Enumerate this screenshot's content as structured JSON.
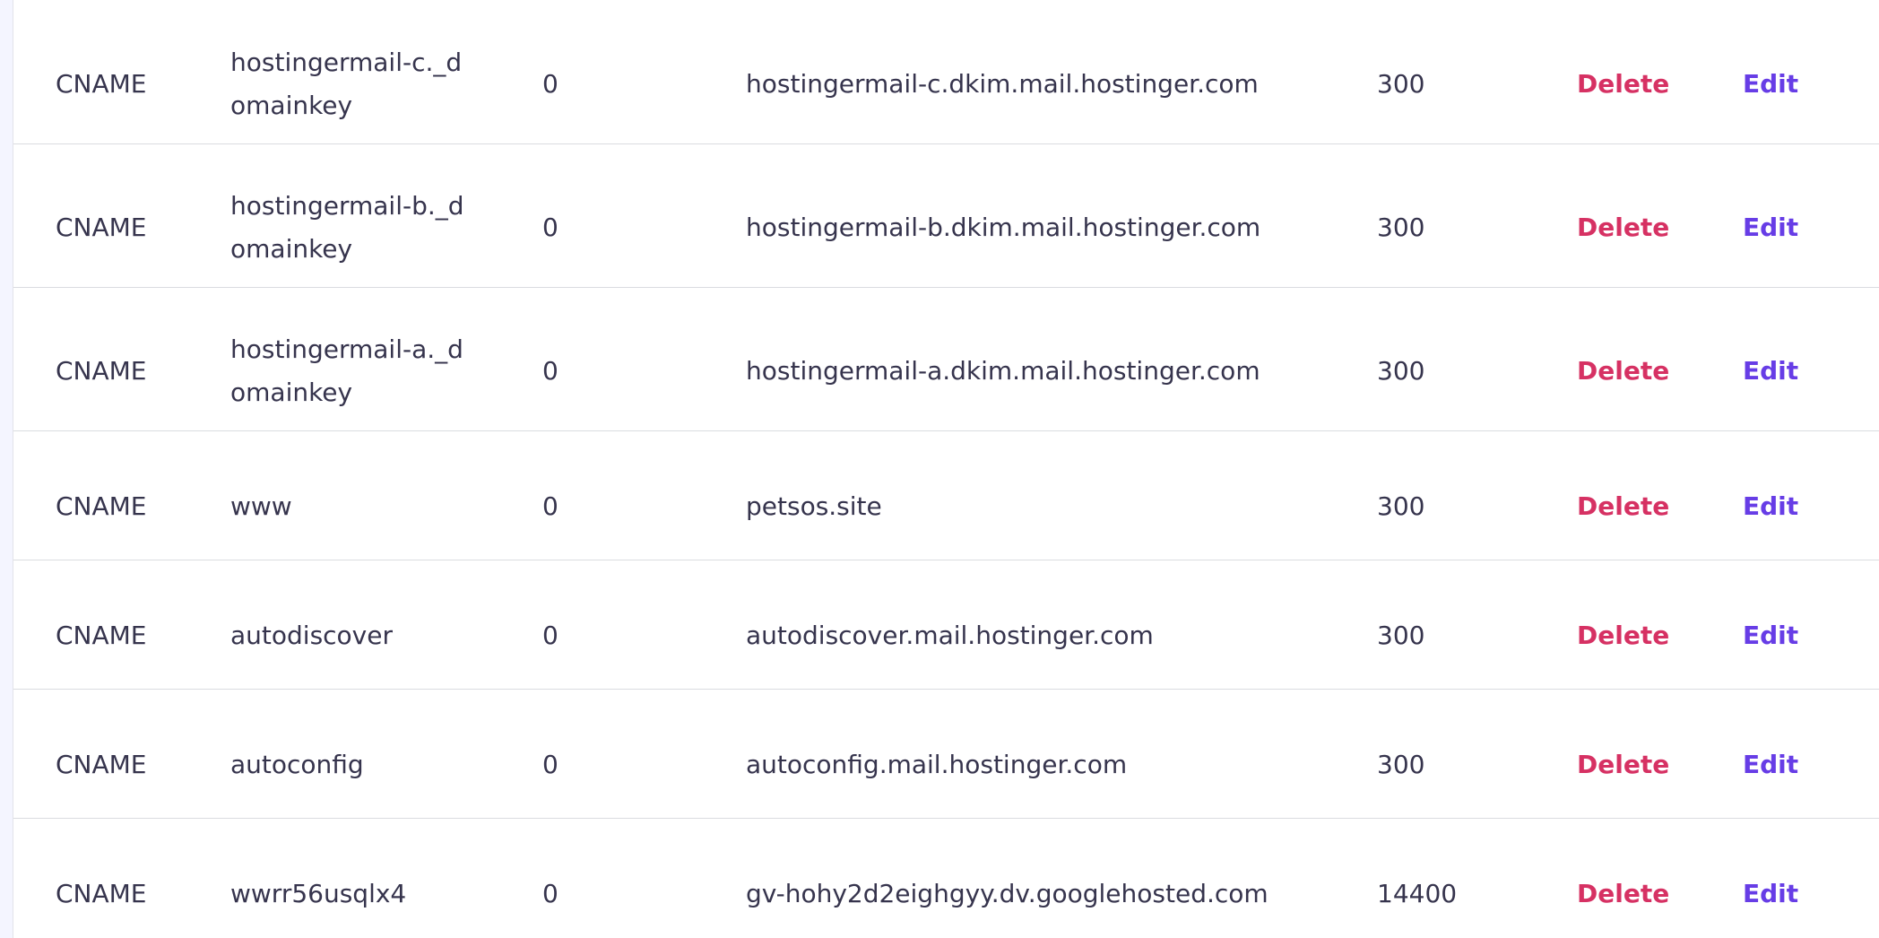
{
  "colors": {
    "delete": "#d63163",
    "edit": "#673de6",
    "text": "#36344d"
  },
  "records": [
    {
      "type": "CNAME",
      "name": "hostingermail-c._domainkey",
      "priority": "0",
      "content": "hostingermail-c.dkim.mail.hostinger.com",
      "ttl": "300",
      "delete_label": "Delete",
      "edit_label": "Edit"
    },
    {
      "type": "CNAME",
      "name": "hostingermail-b._domainkey",
      "priority": "0",
      "content": "hostingermail-b.dkim.mail.hostinger.com",
      "ttl": "300",
      "delete_label": "Delete",
      "edit_label": "Edit"
    },
    {
      "type": "CNAME",
      "name": "hostingermail-a._domainkey",
      "priority": "0",
      "content": "hostingermail-a.dkim.mail.hostinger.com",
      "ttl": "300",
      "delete_label": "Delete",
      "edit_label": "Edit"
    },
    {
      "type": "CNAME",
      "name": "www",
      "priority": "0",
      "content": "petsos.site",
      "ttl": "300",
      "delete_label": "Delete",
      "edit_label": "Edit"
    },
    {
      "type": "CNAME",
      "name": "autodiscover",
      "priority": "0",
      "content": "autodiscover.mail.hostinger.com",
      "ttl": "300",
      "delete_label": "Delete",
      "edit_label": "Edit"
    },
    {
      "type": "CNAME",
      "name": "autoconfig",
      "priority": "0",
      "content": "autoconfig.mail.hostinger.com",
      "ttl": "300",
      "delete_label": "Delete",
      "edit_label": "Edit"
    },
    {
      "type": "CNAME",
      "name": "wwrr56usqlx4",
      "priority": "0",
      "content": "gv-hohy2d2eighgyy.dv.googlehosted.com",
      "ttl": "14400",
      "delete_label": "Delete",
      "edit_label": "Edit"
    }
  ]
}
